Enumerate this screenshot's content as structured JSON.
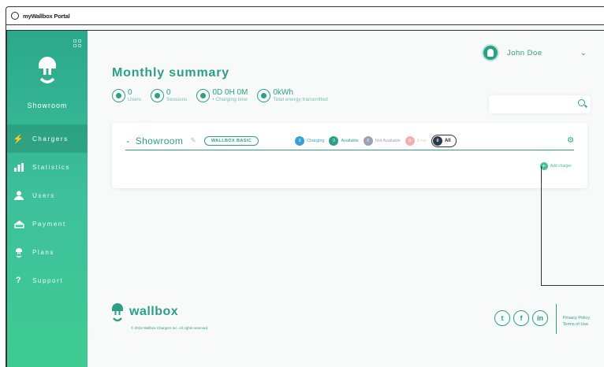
{
  "window": {
    "title": "myWallbox Portal"
  },
  "sidebar": {
    "brand": "Showroom",
    "items": [
      {
        "label": "Chargers",
        "icon": "bolt-icon",
        "active": true
      },
      {
        "label": "Statistics",
        "icon": "bar-chart-icon",
        "active": false
      },
      {
        "label": "Users",
        "icon": "user-icon",
        "active": false
      },
      {
        "label": "Payment",
        "icon": "payment-icon",
        "active": false
      },
      {
        "label": "Plans",
        "icon": "plug-icon",
        "active": false
      },
      {
        "label": "Support",
        "icon": "question-icon",
        "active": false
      }
    ]
  },
  "header": {
    "user_name": "John Doe"
  },
  "summary": {
    "title": "Monthly summary",
    "users_value": "0",
    "users_label": "Users",
    "sessions_value": "0",
    "sessions_label": "Sessions",
    "charging_time_value": "0D 0H 0M",
    "charging_time_label": "• Charging time",
    "energy_value": "0kWh",
    "energy_label": "Total energy transmitted"
  },
  "group": {
    "name": "Showroom",
    "plan": "WALLBOX BASIC",
    "filters": [
      {
        "count": "0",
        "label": "Charging",
        "color": "#3a9ed8"
      },
      {
        "count": "0",
        "label": "Available",
        "color": "#2e9f87"
      },
      {
        "count": "0",
        "label": "Not Available",
        "color": "#9aa3b5"
      },
      {
        "count": "0",
        "label": "Error",
        "color": "#f0b0b0"
      }
    ],
    "all_count": "0",
    "all_label": "All",
    "add_label": "Add charger"
  },
  "footer": {
    "brand": "wallbox",
    "copyright": "© 2019 Wallbox Chargers Inc. All rights reserved.",
    "privacy": "Privacy Policy",
    "terms": "Terms of Use"
  },
  "colors": {
    "accent": "#2e9f87",
    "sidebar": "#3ec09a"
  }
}
